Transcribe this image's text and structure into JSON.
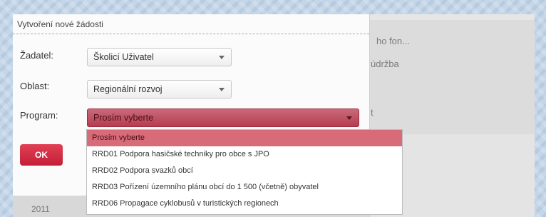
{
  "background": {
    "text_fon": "ho fon...",
    "text_udrzba": "údržba",
    "text_t": "t",
    "footer_year": "2011"
  },
  "dialog": {
    "title": "Vytvoření nové žádosti",
    "fields": {
      "zadatel_label": "Žadatel:",
      "zadatel_value": "Školicí Uživatel",
      "oblast_label": "Oblast:",
      "oblast_value": "Regionální rozvoj",
      "program_label": "Program:",
      "program_value": "Prosím vyberte"
    },
    "ok_label": "OK"
  },
  "dropdown": {
    "options": [
      "Prosím vyberte",
      "RRD01 Podpora hasičské techniky pro obce s JPO",
      "RRD02 Podpora svazků obcí",
      "RRD03 Pořízení územního plánu obcí do 1 500 (včetně) obyvatel",
      "RRD06 Propagace cyklobusů v turistických regionech"
    ],
    "selected_index": 0
  },
  "colors": {
    "accent": "#c41e36",
    "selected_option": "#d86b78"
  }
}
